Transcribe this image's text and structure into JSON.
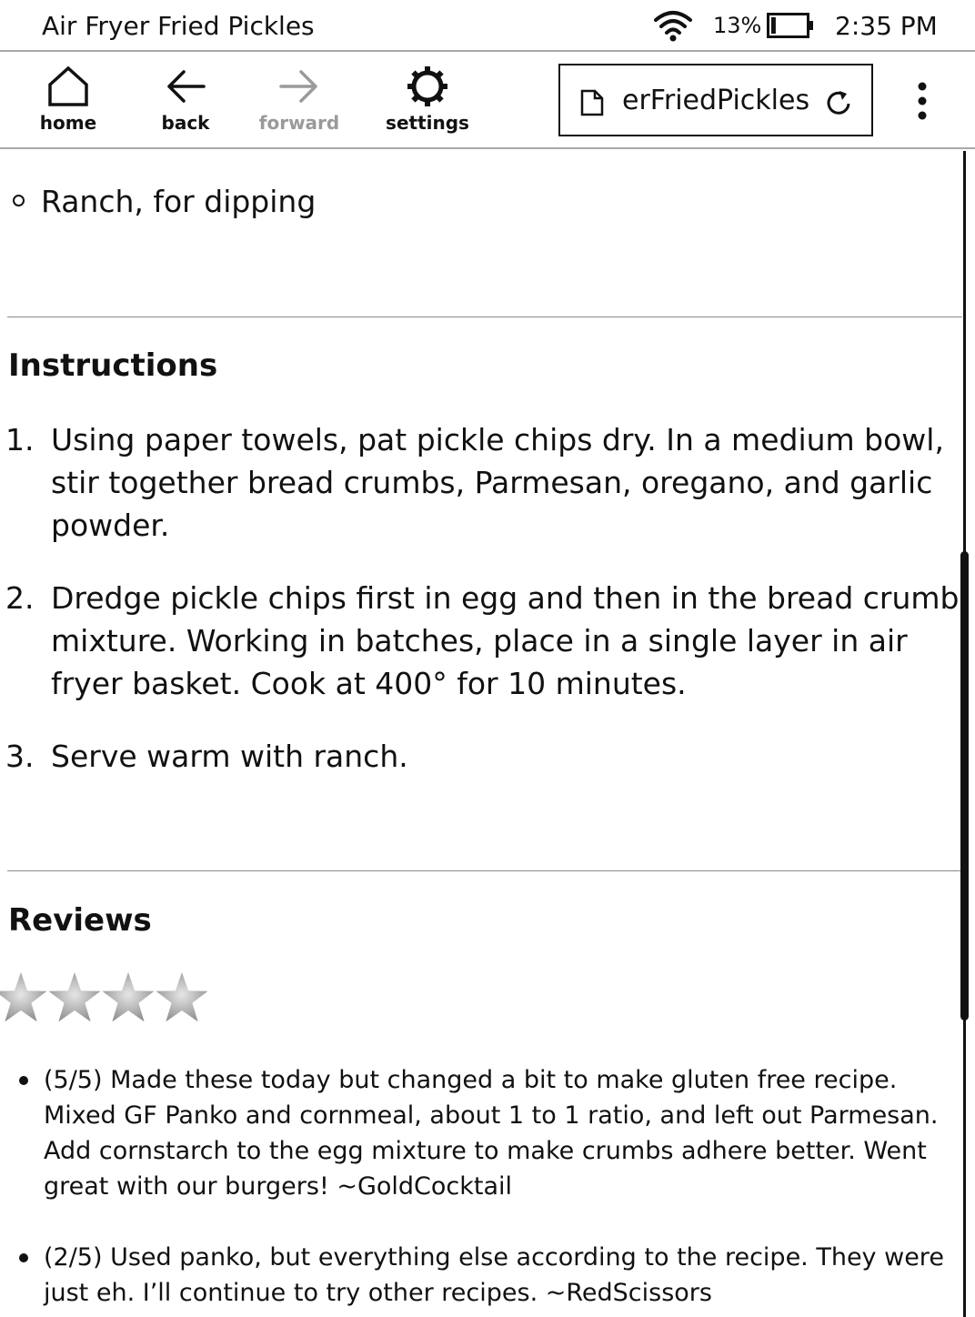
{
  "status_bar": {
    "title": "Air Fryer Fried Pickles",
    "battery_percent": "13%",
    "battery_level": 0.13,
    "time": "2:35 PM"
  },
  "toolbar": {
    "home_label": "home",
    "back_label": "back",
    "forward_label": "forward",
    "settings_label": "settings",
    "url_text": "erFriedPickles"
  },
  "content": {
    "ingredient_item": "Ranch, for dipping",
    "instructions_heading": "Instructions",
    "steps": [
      {
        "num": "1.",
        "text": "Using paper towels, pat pickle chips dry. In a medium bowl, stir together bread crumbs, Parmesan, oregano, and garlic powder."
      },
      {
        "num": "2.",
        "text": "Dredge pickle chips first in egg and then in the bread crumb mixture. Working in batches, place in a single layer in air fryer basket. Cook at 400° for 10 minutes."
      },
      {
        "num": "3.",
        "text": "Serve warm with ranch."
      }
    ],
    "reviews_heading": "Reviews",
    "rating_stars_shown": 4,
    "reviews": [
      {
        "text": "(5/5) Made these today but changed a bit to make gluten free recipe. Mixed GF Panko and cornmeal, about 1 to 1 ratio, and left out Parmesan. Add cornstarch to the egg mixture to make crumbs adhere better. Went great with our burgers! ~GoldCocktail"
      },
      {
        "text": "(2/5) Used panko, but everything else according to the recipe. They were just eh. I’ll continue to try other recipes. ~RedScissors"
      }
    ]
  },
  "colors": {
    "text": "#111111",
    "disabled": "#9a9a9a",
    "divider": "#8a8a8a",
    "star_light": "#e6e6e6",
    "star_dark": "#8c8c8c"
  },
  "icons": [
    "wifi-icon",
    "battery-icon",
    "home-icon",
    "back-arrow-icon",
    "forward-arrow-icon",
    "gear-icon",
    "document-icon",
    "reload-icon",
    "more-vertical-icon",
    "star-icon"
  ]
}
